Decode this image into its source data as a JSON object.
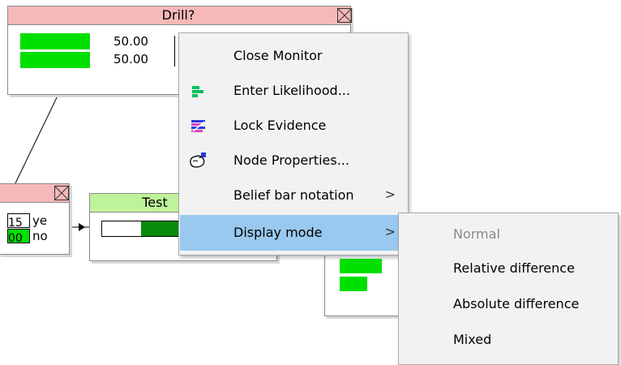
{
  "drill_node": {
    "title": "Drill?",
    "rows": [
      {
        "value": "50.00",
        "prob": 0.5
      },
      {
        "value": "50.00",
        "prob": 0.5
      }
    ],
    "title_color": "#f6b8b8"
  },
  "left_node": {
    "rows": [
      {
        "value_fragment": "15",
        "state_fragment": "ye"
      },
      {
        "value_fragment": "00",
        "state_fragment": "no"
      }
    ],
    "title_color": "#f6b8b8"
  },
  "test_node": {
    "title": "Test",
    "title_color": "#bff39b",
    "bar_color": "#0a8a0a"
  },
  "context_menu": {
    "items": [
      {
        "label": "Close Monitor",
        "icon": "none"
      },
      {
        "label": "Enter Likelihood...",
        "icon": "likelihood-icon"
      },
      {
        "label": "Lock Evidence",
        "icon": "lock-evidence-icon"
      },
      {
        "label": "Node Properties...",
        "icon": "node-properties-icon"
      },
      {
        "label": "Belief bar notation",
        "icon": "none",
        "arrow": ">"
      },
      {
        "label": "Display mode",
        "icon": "none",
        "arrow": ">",
        "highlighted": true
      }
    ],
    "highlight_color": "#99c9ef"
  },
  "submenu": {
    "items": [
      {
        "label": "Normal",
        "disabled": true
      },
      {
        "label": "Relative difference"
      },
      {
        "label": "Absolute difference"
      },
      {
        "label": "Mixed"
      }
    ]
  }
}
